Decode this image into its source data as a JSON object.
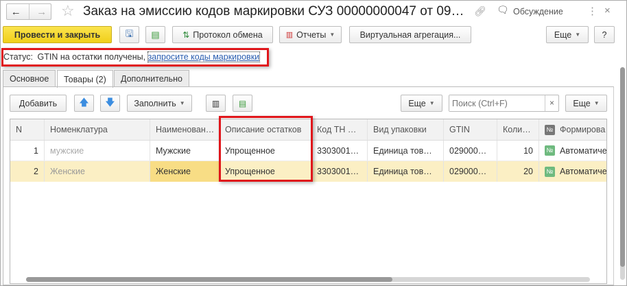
{
  "window": {
    "title": "Заказ на эмиссию кодов маркировки СУЗ 00000000047 от 09…",
    "discussion": "Обсуждение",
    "close": "×",
    "more": "⋮"
  },
  "toolbar": {
    "post_close": "Провести и закрыть",
    "exchange_log": "Протокол обмена",
    "reports": "Отчеты",
    "virtual_aggregation": "Виртуальная агрегация...",
    "more": "Еще",
    "help": "?"
  },
  "status": {
    "label": "Статус:",
    "text": "GTIN на остатки получены,",
    "link": "запросите коды маркировки"
  },
  "tabs": [
    {
      "label": "Основное"
    },
    {
      "label": "Товары (2)"
    },
    {
      "label": "Дополнительно"
    }
  ],
  "table_toolbar": {
    "add": "Добавить",
    "fill": "Заполнить",
    "more1": "Еще",
    "search_placeholder": "Поиск (Ctrl+F)",
    "clear": "×",
    "more2": "Еще"
  },
  "table": {
    "columns": [
      "N",
      "Номенклатура",
      "Наименован…",
      "Описание остатков",
      "Код ТН …",
      "Вид упаковки",
      "GTIN",
      "Коли…",
      "Формирова"
    ],
    "rows": [
      {
        "n": "1",
        "nom": "мужские",
        "name": "Мужские",
        "desc": "Упрощенное",
        "tn": "3303001…",
        "pack": "Единица тов…",
        "gtin": "029000…",
        "qty": "10",
        "form": "Автоматиче"
      },
      {
        "n": "2",
        "nom": "Женские",
        "name": "Женские",
        "desc": "Упрощенное",
        "tn": "3303001…",
        "pack": "Единица тов…",
        "gtin": "029000…",
        "qty": "20",
        "form": "Автоматиче"
      }
    ]
  },
  "colors": {
    "accent": "#f0cf1a",
    "highlight": "#e0161b",
    "selected_row": "#fbefc4",
    "badge": "#6fba7f"
  }
}
